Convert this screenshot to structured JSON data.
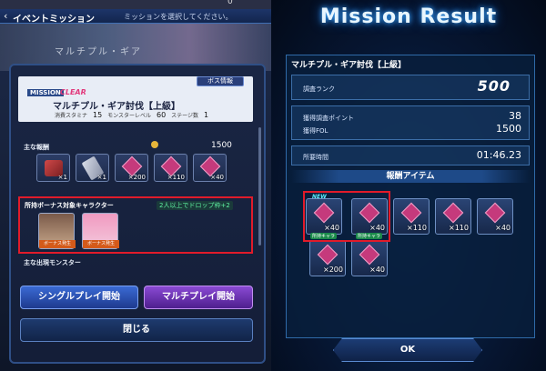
{
  "left": {
    "top_number": "0",
    "title": "イベントミッション",
    "subtitle": "ミッションを選択してください。",
    "banner_text": "マルチプル・ギア",
    "mission": {
      "mission_label": "MISSION",
      "clear_label": "CLEAR",
      "boss_info_button": "ボス情報",
      "name": "マルチプル・ギア討伐【上級】",
      "stamina_label": "消費スタミナ",
      "stamina_value": "15",
      "monster_level_label": "モンスターレベル",
      "monster_level_value": "60",
      "stages_label": "ステージ数",
      "stages_value": "1"
    },
    "main_reward_label": "主な報酬",
    "main_reward_amount": "1500",
    "rewards": [
      {
        "icon": "weapon-icon",
        "qty": "×1"
      },
      {
        "icon": "hammer-icon",
        "qty": "×1"
      },
      {
        "icon": "crystal-icon",
        "qty": "×200"
      },
      {
        "icon": "crystal-icon",
        "qty": "×110"
      },
      {
        "icon": "crystal-icon",
        "qty": "×40"
      }
    ],
    "bonus": {
      "title": "所持ボーナス対象キャラクター",
      "drop_text": "2人以上でドロップ枠+2",
      "chara1_tag": "ボーナス発生",
      "chara2_tag": "ボーナス発生"
    },
    "monster_label": "主な出現モンスター",
    "single_play": "シングルプレイ開始",
    "multi_play": "マルチプレイ開始",
    "close": "閉じる"
  },
  "right": {
    "title": "Mission Result",
    "mission_name": "マルチプル・ギア討伐【上級】",
    "rank_label": "調査ランク",
    "rank_value": "500",
    "points_label": "獲得調査ポイント",
    "points_value": "38",
    "fol_label": "獲得FOL",
    "fol_value": "1500",
    "time_label": "所要時間",
    "time_value": "01:46.23",
    "reward_items_title": "報酬アイテム",
    "items_row1": [
      {
        "qty": "×40",
        "new": "NEW",
        "tag": "所持キャラ"
      },
      {
        "qty": "×40",
        "new": "",
        "tag": "所持キャラ"
      },
      {
        "qty": "×110",
        "new": "",
        "tag": ""
      },
      {
        "qty": "×110",
        "new": "",
        "tag": ""
      },
      {
        "qty": "×40",
        "new": "",
        "tag": ""
      }
    ],
    "items_row2": [
      {
        "qty": "×200"
      },
      {
        "qty": "×40"
      }
    ],
    "ok_button": "OK"
  }
}
